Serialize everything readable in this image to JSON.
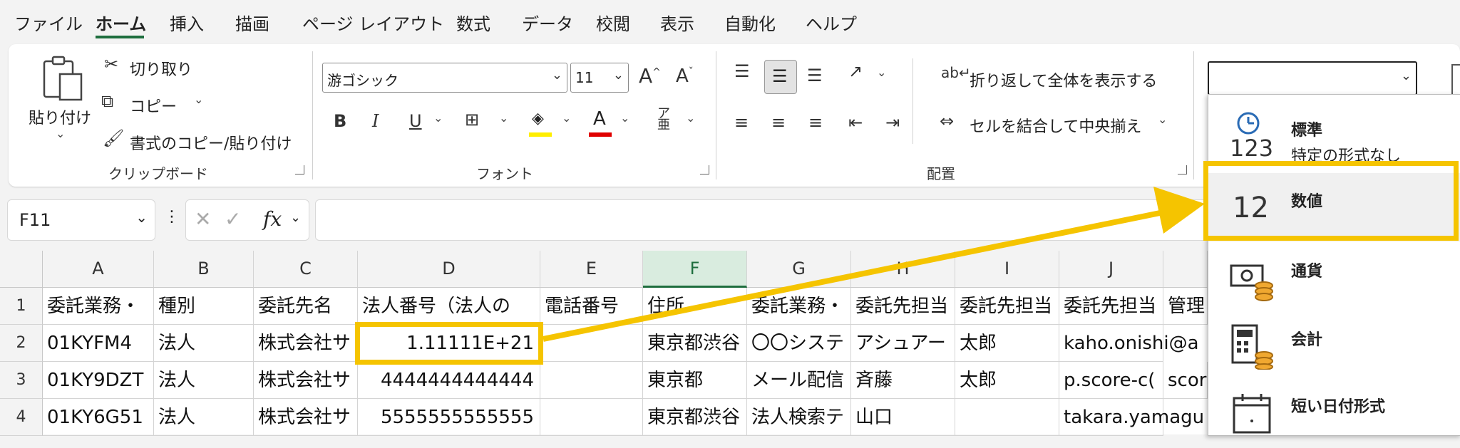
{
  "menu": {
    "items": [
      "ファイル",
      "ホーム",
      "挿入",
      "描画",
      "ページ レイアウト",
      "数式",
      "データ",
      "校閲",
      "表示",
      "自動化",
      "ヘルプ"
    ],
    "active": "ホーム"
  },
  "ribbon": {
    "clipboard": {
      "paste": "貼り付け",
      "cut": "切り取り",
      "copy": "コピー",
      "format_painter": "書式のコピー/貼り付け",
      "label": "クリップボード"
    },
    "font": {
      "font_name": "游ゴシック",
      "font_size": "11",
      "bold": "B",
      "italic": "I",
      "underline": "U",
      "font_color_glyph": "A",
      "grow": "A",
      "shrink": "A",
      "label": "フォント"
    },
    "alignment": {
      "wrap": "折り返して全体を表示する",
      "merge": "セルを結合して中央揃え",
      "label": "配置"
    },
    "number": {
      "format_value": ""
    }
  },
  "formula_bar": {
    "name_box": "F11",
    "fx": "fx",
    "formula": ""
  },
  "sheet": {
    "columns": [
      "A",
      "B",
      "C",
      "D",
      "E",
      "F",
      "G",
      "H",
      "I",
      "J"
    ],
    "selected_column": "F",
    "rows": [
      {
        "n": "1",
        "cells": [
          "委託業務・",
          "種別",
          "委託先名",
          "法人番号（法人の",
          "電話番号",
          "住所",
          "委託業務・",
          "委託先担当",
          "委託先担当",
          "委託先担当",
          "管理"
        ]
      },
      {
        "n": "2",
        "cells": [
          "01KYFM4",
          "法人",
          "株式会社サ",
          "1.11111E+21",
          "",
          "東京都渋谷",
          "〇〇システ",
          "アシュアー",
          "太郎",
          "kaho.onishi@a",
          ""
        ]
      },
      {
        "n": "3",
        "cells": [
          "01KY9DZT",
          "法人",
          "株式会社サ",
          "4444444444444",
          "",
          "東京都",
          "メール配信",
          "斉藤",
          "太郎",
          "p.score-c(",
          "scor"
        ]
      },
      {
        "n": "4",
        "cells": [
          "01KY6G51",
          "法人",
          "株式会社サ",
          "5555555555555",
          "",
          "東京都渋谷",
          "法人検索テ",
          "山口",
          "",
          "takara.yamagu",
          ""
        ]
      }
    ]
  },
  "number_format_menu": {
    "items": [
      {
        "title": "標準",
        "subtitle": "特定の形式なし",
        "icon": "clock-123-icon",
        "icon_text": "123"
      },
      {
        "title": "数値",
        "subtitle": "",
        "icon": "number-12-icon",
        "icon_text": "12"
      },
      {
        "title": "通貨",
        "subtitle": "",
        "icon": "currency-icon",
        "icon_text": ""
      },
      {
        "title": "会計",
        "subtitle": "",
        "icon": "accounting-icon",
        "icon_text": ""
      },
      {
        "title": "短い日付形式",
        "subtitle": "",
        "icon": "calendar-icon",
        "icon_text": ""
      }
    ]
  },
  "colors": {
    "accent_green": "#1e6e3e",
    "highlight_yellow": "#f5c400",
    "font_color_red": "#e00000",
    "highlight_fill_yellow": "#ffee00"
  }
}
